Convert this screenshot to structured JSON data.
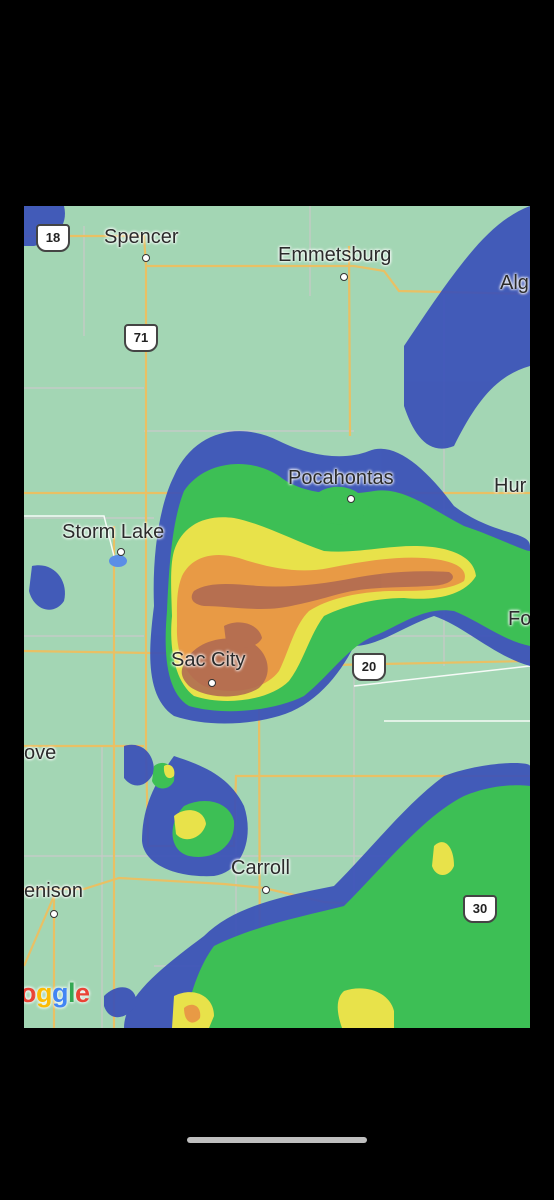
{
  "map": {
    "cities": {
      "spencer": "Spencer",
      "emmetsburg": "Emmetsburg",
      "algona": "Alg",
      "pocahontas": "Pocahontas",
      "humboldt": "Hur",
      "storm_lake": "Storm Lake",
      "sac_city": "Sac City",
      "fort_dodge": "Fo",
      "ida_grove": "ove",
      "carroll": "Carroll",
      "denison": "enison"
    },
    "routes": {
      "us_18": "18",
      "us_71": "71",
      "us_20": "20",
      "us_30": "30"
    },
    "attribution": {
      "letters": [
        "o",
        "g",
        "l",
        "e"
      ],
      "colors": [
        "#ea4335",
        "#fbbc05",
        "#4285f4",
        "#34a853",
        "#ea4335"
      ]
    },
    "radar_colors": {
      "light": "#3a50b8",
      "moderate": "#3dbf55",
      "heavy": "#e8e24a",
      "very_heavy": "#e89a45",
      "intense": "#b06a52"
    }
  }
}
